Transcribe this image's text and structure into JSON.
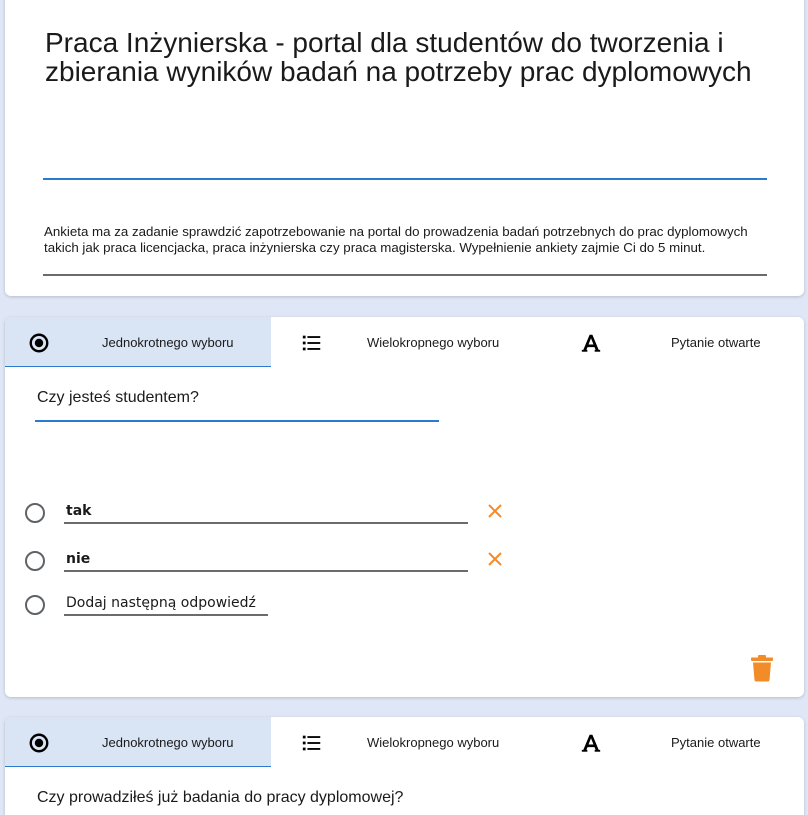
{
  "form": {
    "title": "Praca Inżynierska - portal dla studentów do tworzenia i zbierania wyników badań na potrzeby prac dyplomowych",
    "description": "Ankieta ma za zadanie sprawdzić zapotrzebowanie na portal do prowadzenia badań potrzebnych do prac dyplomowych takich jak praca licencjacka, praca inżynierska czy praca magisterska. Wypełnienie ankiety zajmie Ci do 5 minut."
  },
  "question_types": {
    "single": "Jednokrotnego wyboru",
    "multi": "Wielokropnego wyboru",
    "open": "Pytanie otwarte"
  },
  "questions": [
    {
      "text": "Czy jesteś studentem?",
      "active_type": "single",
      "options": [
        "tak",
        "nie"
      ],
      "add_option_label": "Dodaj następną odpowiedź"
    },
    {
      "text": "Czy prowadziłeś już badania do pracy dyplomowej?",
      "active_type": "single"
    }
  ],
  "icons": {
    "single": "radio-checked-icon",
    "multi": "list-icon",
    "open": "text-format-icon",
    "remove": "close-icon",
    "delete": "trash-icon"
  },
  "colors": {
    "accent": "#2a7bd0",
    "active_tab_bg": "#d9e4f4",
    "danger": "#f28c28",
    "page_bg": "#dfe6f5"
  }
}
